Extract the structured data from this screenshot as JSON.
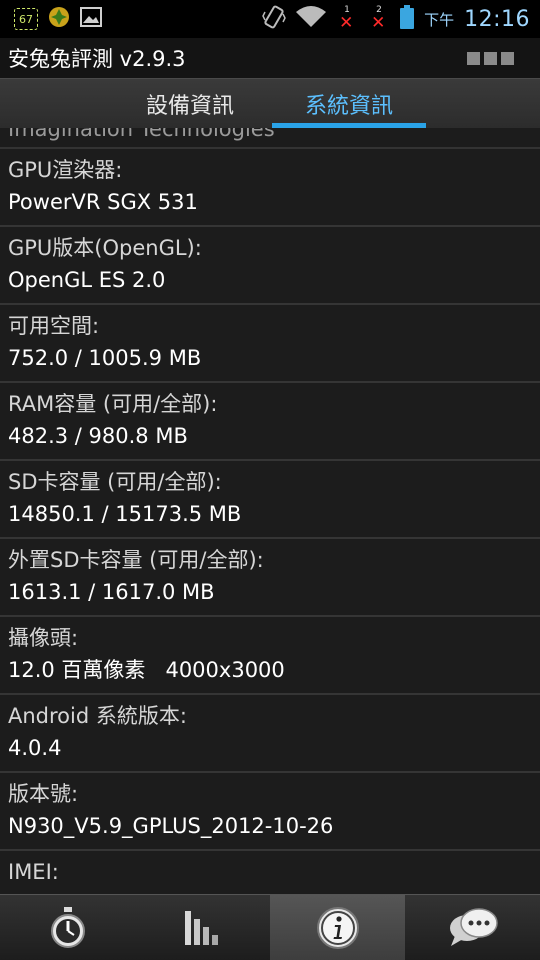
{
  "status": {
    "badge": "67",
    "sim1": "1",
    "sim2": "2",
    "ampm": "下午",
    "time": "12:16"
  },
  "app": {
    "title": "安兔兔評測 v2.9.3"
  },
  "tabs": [
    {
      "label": "設備資訊",
      "selected": false
    },
    {
      "label": "系統資訊",
      "selected": true
    }
  ],
  "partial_row": "Imagination Technologies",
  "items": [
    {
      "label": "GPU渲染器:",
      "value": "PowerVR SGX 531"
    },
    {
      "label": "GPU版本(OpenGL):",
      "value": "OpenGL ES 2.0"
    },
    {
      "label": "可用空間:",
      "value": "752.0 / 1005.9 MB"
    },
    {
      "label": "RAM容量 (可用/全部):",
      "value": "482.3 / 980.8 MB"
    },
    {
      "label": "SD卡容量 (可用/全部):",
      "value": "14850.1 / 15173.5 MB"
    },
    {
      "label": "外置SD卡容量 (可用/全部):",
      "value": "1613.1 / 1617.0 MB"
    },
    {
      "label": "攝像頭:",
      "value": "12.0 百萬像素   4000x3000"
    },
    {
      "label": "Android 系統版本:",
      "value": "4.0.4"
    },
    {
      "label": "版本號:",
      "value": "N930_V5.9_GPLUS_2012-10-26"
    },
    {
      "label": "IMEI:",
      "value": ""
    }
  ],
  "nav": [
    {
      "icon": "stopwatch-icon",
      "selected": false
    },
    {
      "icon": "bar-chart-icon",
      "selected": false
    },
    {
      "icon": "info-icon",
      "selected": true
    },
    {
      "icon": "chat-bubbles-icon",
      "selected": false
    }
  ],
  "colors": {
    "accent": "#2aa3e8",
    "time": "#9fd7ff",
    "error_x": "#ff2a2a"
  }
}
